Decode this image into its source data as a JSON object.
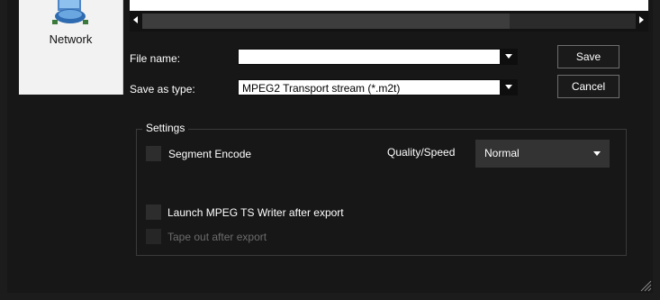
{
  "places": {
    "network_label": "Network"
  },
  "form": {
    "file_name_label": "File name:",
    "file_name_value": "",
    "save_as_type_label": "Save as type:",
    "save_as_type_value": "MPEG2 Transport stream (*.m2t)"
  },
  "buttons": {
    "save": "Save",
    "cancel": "Cancel"
  },
  "settings": {
    "legend": "Settings",
    "segment_encode_label": "Segment Encode",
    "segment_encode_checked": false,
    "quality_speed_label": "Quality/Speed",
    "quality_speed_value": "Normal",
    "launch_writer_label": "Launch MPEG TS Writer after export",
    "launch_writer_checked": false,
    "tape_out_label": "Tape out after export",
    "tape_out_checked": false,
    "tape_out_enabled": false
  },
  "icons": {
    "network": "network-icon",
    "scroll_left": "arrow-left-icon",
    "scroll_right": "arrow-right-icon",
    "dropdown": "chevron-down-icon",
    "resize": "resize-grip-icon"
  },
  "colors": {
    "background": "#171717",
    "places_bg": "#f2f2f2",
    "button_border": "#6e6e6e",
    "disabled_text": "#6c6c6c"
  }
}
